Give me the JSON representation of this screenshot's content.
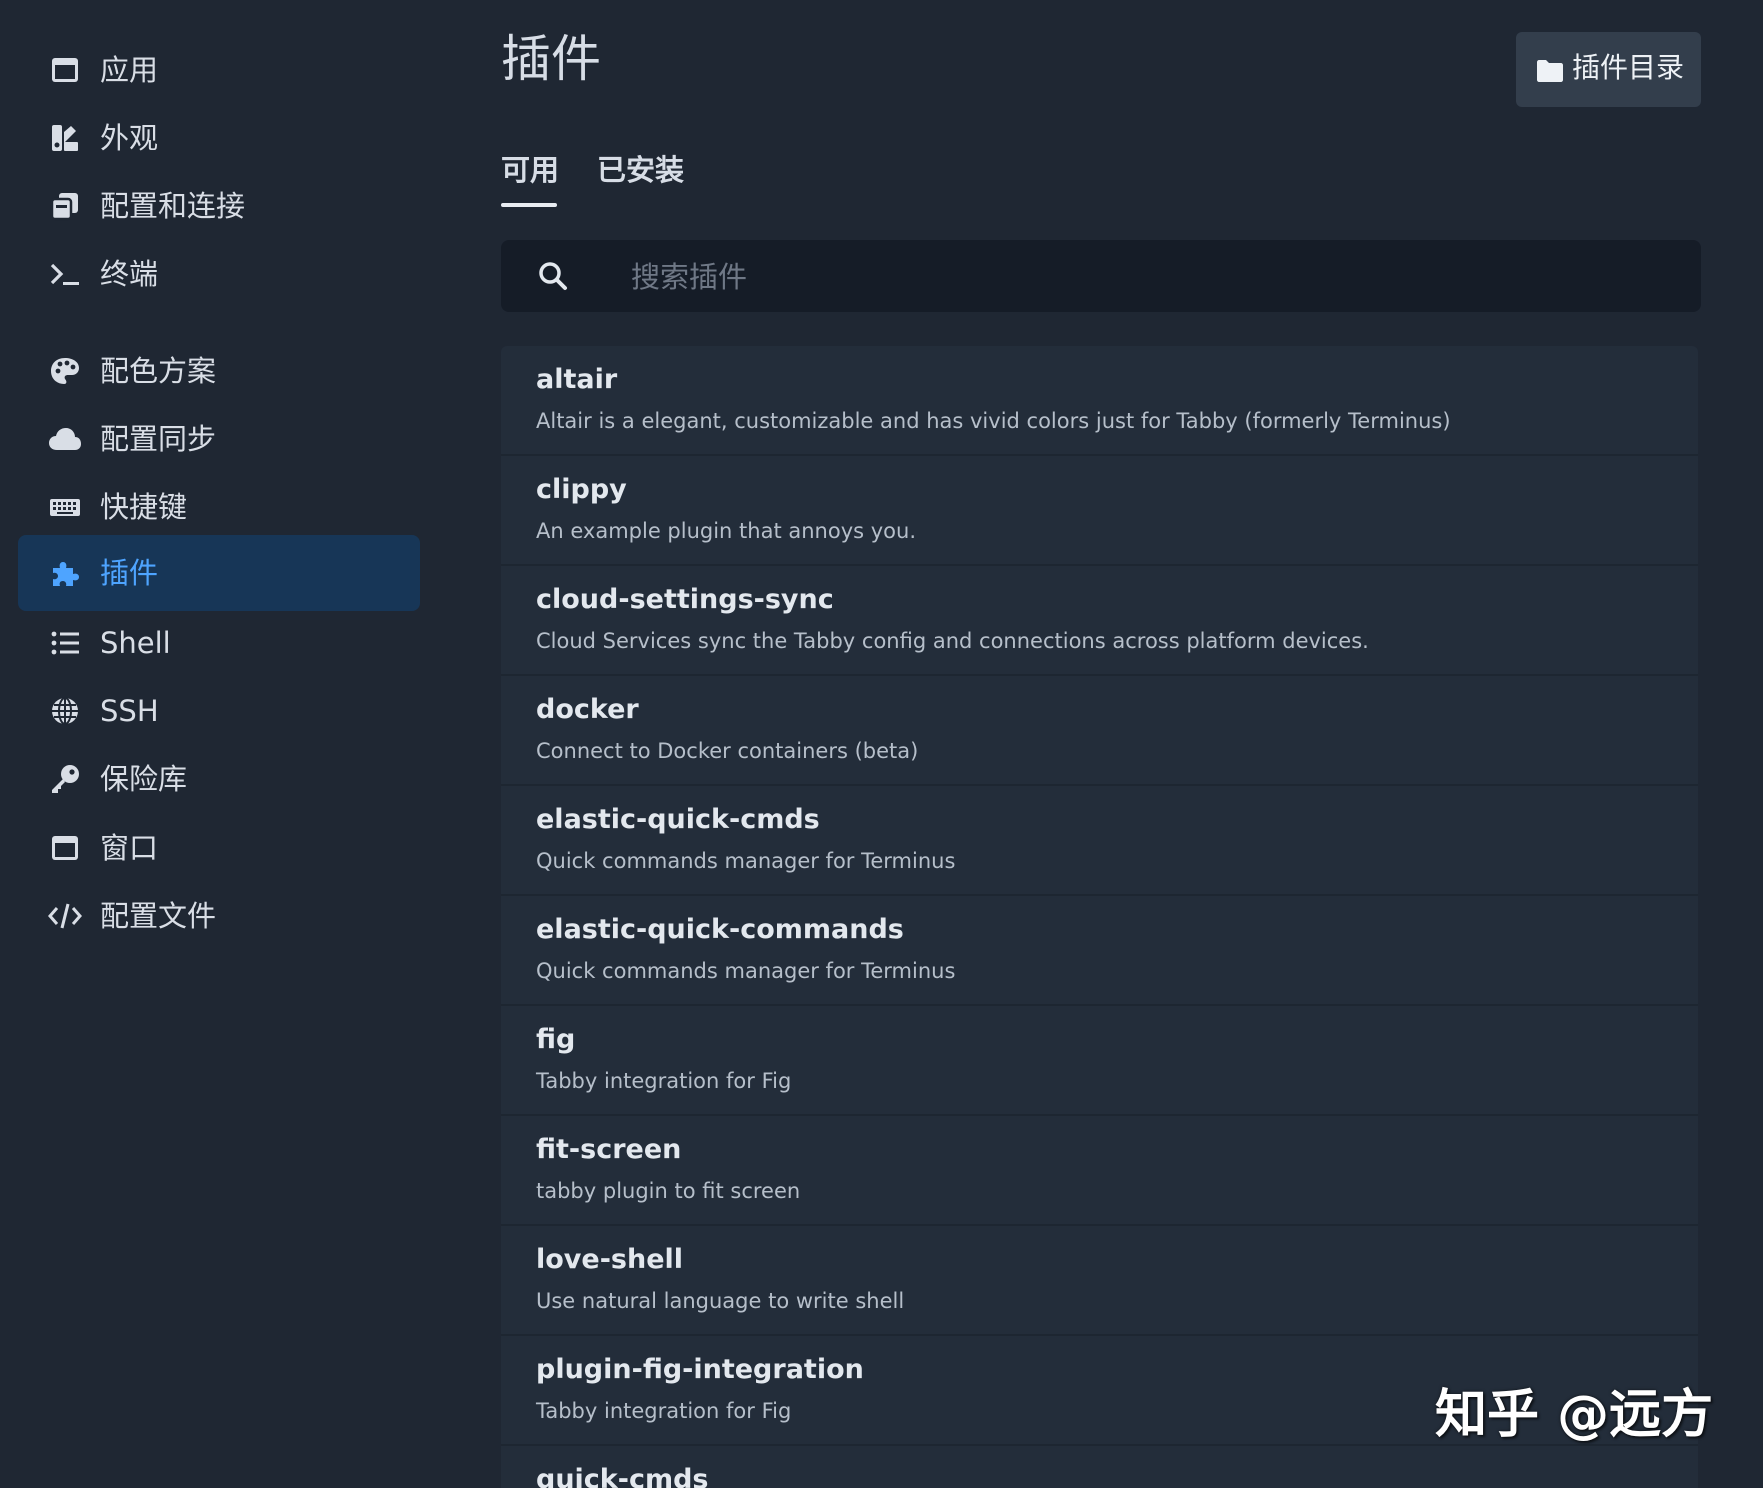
{
  "sidebar": {
    "items": [
      {
        "label": "应用",
        "icon": "window-icon",
        "active": false
      },
      {
        "label": "外观",
        "icon": "swatchbook-icon",
        "active": false
      },
      {
        "label": "配置和连接",
        "icon": "copy-icon",
        "active": false
      },
      {
        "label": "终端",
        "icon": "terminal-icon",
        "active": false
      },
      {
        "label": "配色方案",
        "icon": "palette-icon",
        "active": false
      },
      {
        "label": "配置同步",
        "icon": "cloud-icon",
        "active": false
      },
      {
        "label": "快捷键",
        "icon": "keyboard-icon",
        "active": false
      },
      {
        "label": "插件",
        "icon": "puzzle-icon",
        "active": true
      },
      {
        "label": "Shell",
        "icon": "list-icon",
        "active": false
      },
      {
        "label": "SSH",
        "icon": "globe-icon",
        "active": false
      },
      {
        "label": "保险库",
        "icon": "key-icon",
        "active": false
      },
      {
        "label": "窗口",
        "icon": "window-icon",
        "active": false
      },
      {
        "label": "配置文件",
        "icon": "code-icon",
        "active": false
      }
    ]
  },
  "main": {
    "title": "插件",
    "dir_button": {
      "label": "插件目录",
      "icon": "folder-icon"
    },
    "tabs": [
      {
        "label": "可用",
        "active": true
      },
      {
        "label": "已安装",
        "active": false
      }
    ],
    "search": {
      "placeholder": "搜索插件",
      "value": ""
    },
    "plugins": [
      {
        "name": "altair",
        "desc": "Altair is a elegant, customizable and has vivid colors just for Tabby (formerly Terminus)"
      },
      {
        "name": "clippy",
        "desc": "An example plugin that annoys you."
      },
      {
        "name": "cloud-settings-sync",
        "desc": "Cloud Services sync the Tabby config and connections across platform devices."
      },
      {
        "name": "docker",
        "desc": "Connect to Docker containers (beta)"
      },
      {
        "name": "elastic-quick-cmds",
        "desc": "Quick commands manager for Terminus"
      },
      {
        "name": "elastic-quick-commands",
        "desc": "Quick commands manager for Terminus"
      },
      {
        "name": "fig",
        "desc": "Tabby integration for Fig"
      },
      {
        "name": "fit-screen",
        "desc": "tabby plugin to fit screen"
      },
      {
        "name": "love-shell",
        "desc": "Use natural language to write shell"
      },
      {
        "name": "plugin-fig-integration",
        "desc": "Tabby integration for Fig"
      },
      {
        "name": "quick-cmds",
        "desc": ""
      }
    ]
  },
  "watermark": "知乎 @远方",
  "colors": {
    "background": "#1f2733",
    "active_nav_bg": "#173657",
    "active_nav_text": "#4ea4ff",
    "search_bg": "#151c27",
    "list_bg": "#232d3a",
    "button_bg": "#333e4c"
  }
}
